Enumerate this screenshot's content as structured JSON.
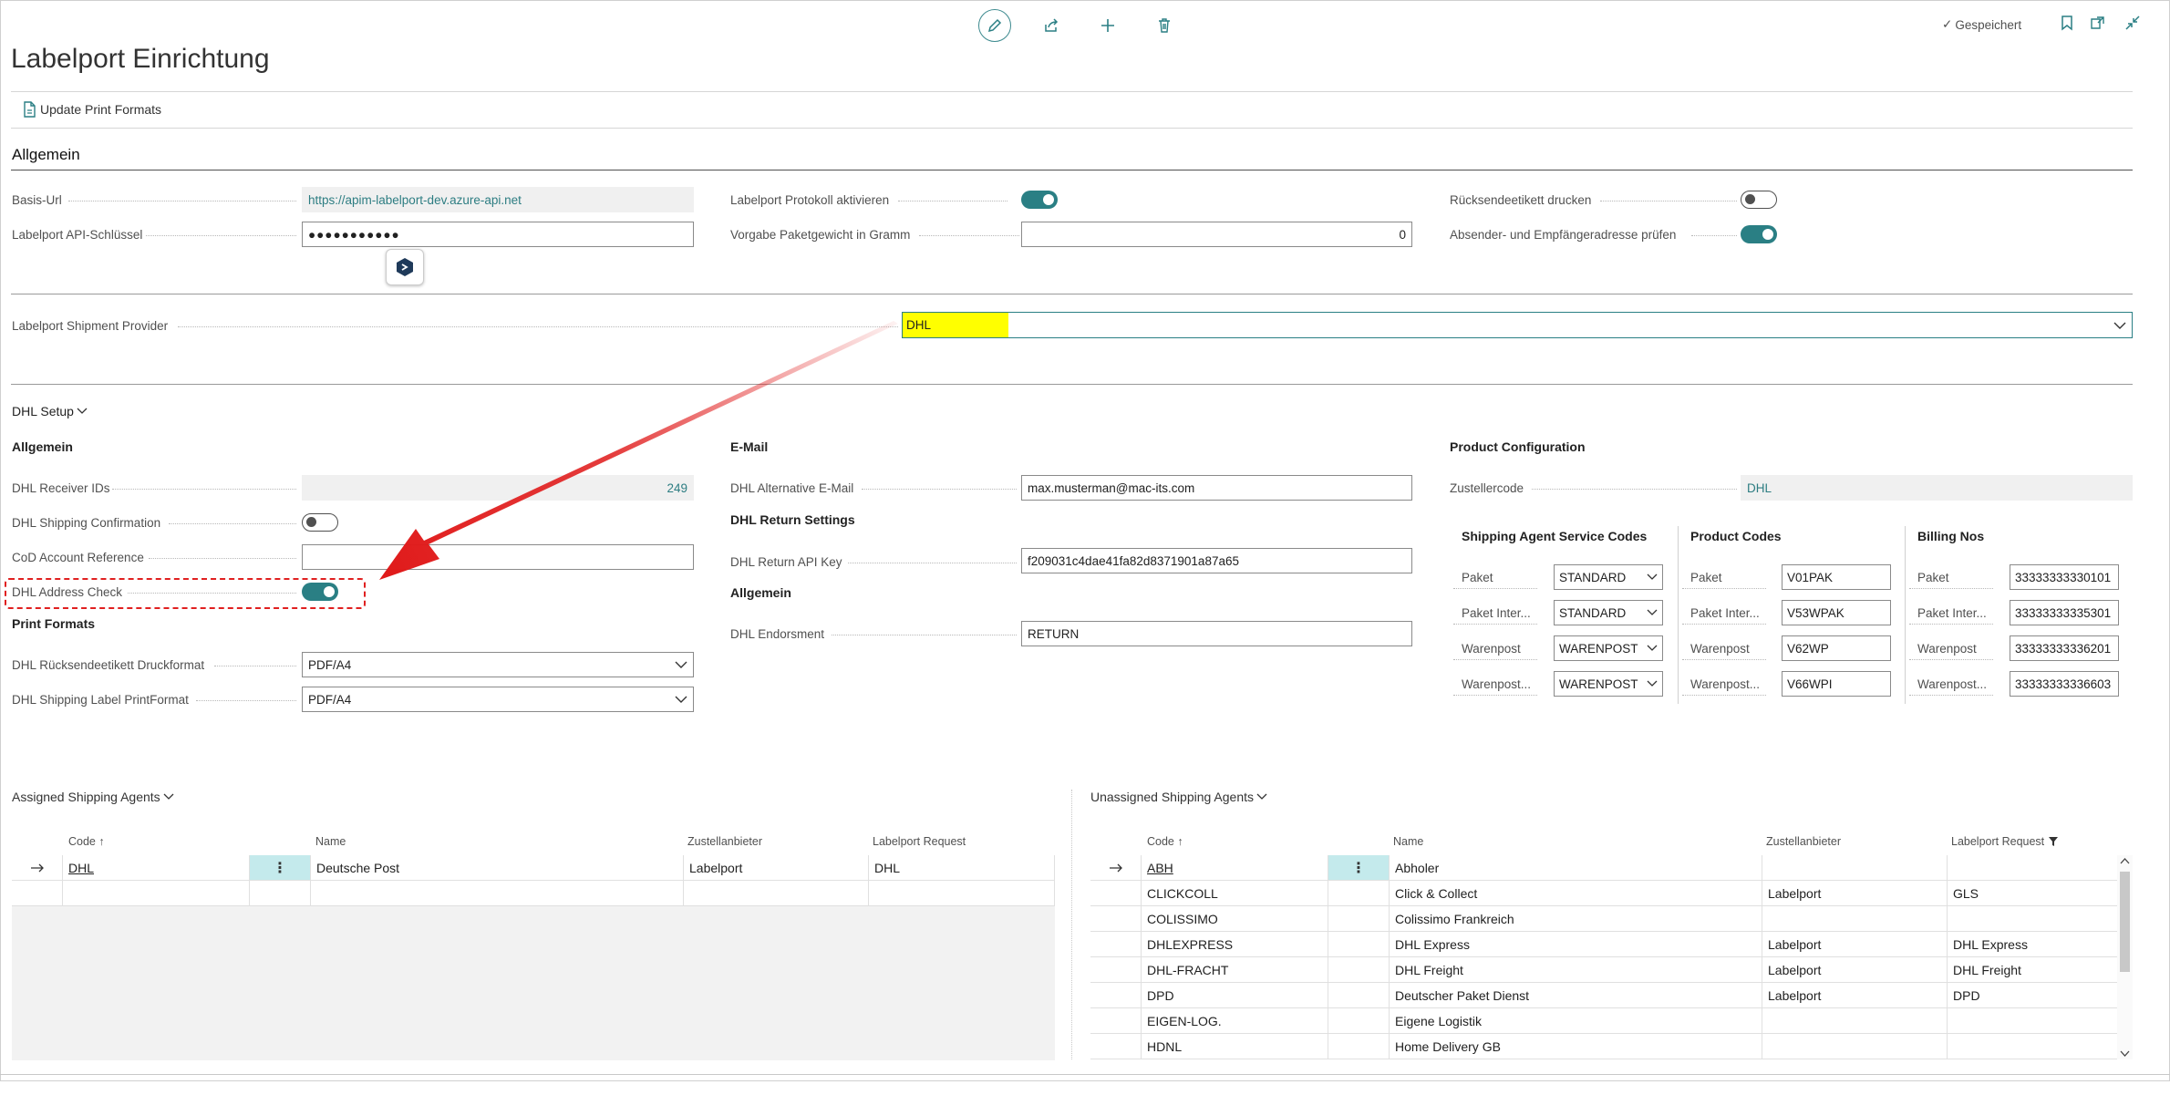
{
  "toolbar": {
    "saved_label": "Gespeichert"
  },
  "page": {
    "title": "Labelport Einrichtung"
  },
  "actions": {
    "update_print_formats": "Update Print Formats"
  },
  "general": {
    "heading": "Allgemein",
    "basis_url_label": "Basis-Url",
    "basis_url_value": "https://apim-labelport-dev.azure-api.net",
    "api_key_label": "Labelport API-Schlüssel",
    "api_key_value": "●●●●●●●●●●●",
    "protokoll_label": "Labelport Protokoll aktivieren",
    "protokoll_on": true,
    "paketgewicht_label": "Vorgabe Paketgewicht in Gramm",
    "paketgewicht_value": "0",
    "ruecksende_label": "Rücksendeetikett drucken",
    "ruecksende_on": false,
    "adresse_label": "Absender- und Empfängeradresse prüfen",
    "adresse_on": true,
    "provider_label": "Labelport Shipment Provider",
    "provider_value": "DHL"
  },
  "dhl": {
    "heading": "DHL Setup",
    "col1_heading": "Allgemein",
    "receiver_ids_label": "DHL Receiver IDs",
    "receiver_ids_value": "249",
    "shipping_conf_label": "DHL Shipping Confirmation",
    "cod_label": "CoD Account Reference",
    "cod_value": "",
    "address_check_label": "DHL Address Check",
    "print_formats_heading": "Print Formats",
    "ruecksende_format_label": "DHL Rücksendeetikett Druckformat",
    "ruecksende_format_value": "PDF/A4",
    "shipping_label_format_label": "DHL Shipping Label PrintFormat",
    "shipping_label_format_value": "PDF/A4",
    "email_heading": "E-Mail",
    "alt_email_label": "DHL Alternative E-Mail",
    "alt_email_value": "max.musterman@mac-its.com",
    "return_settings_heading": "DHL Return Settings",
    "return_api_key_label": "DHL Return API Key",
    "return_api_key_value": "f209031c4dae41fa82d8371901a87a65",
    "col2_allgemein_heading": "Allgemein",
    "endorsment_label": "DHL Endorsment",
    "endorsment_value": "RETURN",
    "product_config_heading": "Product Configuration",
    "zustellercode_label": "Zustellercode",
    "zustellercode_value": "DHL",
    "service_codes_heading": "Shipping Agent Service Codes",
    "product_codes_heading": "Product Codes",
    "billing_nos_heading": "Billing Nos",
    "service_codes": [
      {
        "label": "Paket",
        "value": "STANDARD"
      },
      {
        "label": "Paket Inter...",
        "value": "STANDARD"
      },
      {
        "label": "Warenpost",
        "value": "WARENPOST"
      },
      {
        "label": "Warenpost...",
        "value": "WARENPOST"
      }
    ],
    "product_codes": [
      {
        "label": "Paket",
        "value": "V01PAK"
      },
      {
        "label": "Paket Inter...",
        "value": "V53WPAK"
      },
      {
        "label": "Warenpost",
        "value": "V62WP"
      },
      {
        "label": "Warenpost...",
        "value": "V66WPI"
      }
    ],
    "billing_nos": [
      {
        "label": "Paket",
        "value": "33333333330101"
      },
      {
        "label": "Paket Inter...",
        "value": "33333333335301"
      },
      {
        "label": "Warenpost",
        "value": "33333333336201"
      },
      {
        "label": "Warenpost...",
        "value": "33333333336603"
      }
    ]
  },
  "assigned": {
    "caption": "Assigned Shipping Agents",
    "headers": {
      "code": "Code ↑",
      "name": "Name",
      "zustellanbieter": "Zustellanbieter",
      "request": "Labelport Request"
    },
    "rows": [
      {
        "code": "DHL",
        "name": "Deutsche Post",
        "zustellanbieter": "Labelport",
        "request": "DHL"
      }
    ]
  },
  "unassigned": {
    "caption": "Unassigned Shipping Agents",
    "headers": {
      "code": "Code ↑",
      "name": "Name",
      "zustellanbieter": "Zustellanbieter",
      "request": "Labelport Request"
    },
    "rows": [
      {
        "code": "ABH",
        "name": "Abholer",
        "zustellanbieter": "",
        "request": ""
      },
      {
        "code": "CLICKCOLL",
        "name": "Click & Collect",
        "zustellanbieter": "Labelport",
        "request": "GLS"
      },
      {
        "code": "COLISSIMO",
        "name": "Colissimo Frankreich",
        "zustellanbieter": "",
        "request": ""
      },
      {
        "code": "DHLEXPRESS",
        "name": "DHL Express",
        "zustellanbieter": "Labelport",
        "request": "DHL Express"
      },
      {
        "code": "DHL-FRACHT",
        "name": "DHL Freight",
        "zustellanbieter": "Labelport",
        "request": "DHL Freight"
      },
      {
        "code": "DPD",
        "name": "Deutscher Paket Dienst",
        "zustellanbieter": "Labelport",
        "request": "DPD"
      },
      {
        "code": "EIGEN-LOG.",
        "name": "Eigene Logistik",
        "zustellanbieter": "",
        "request": ""
      },
      {
        "code": "HDNL",
        "name": "Home Delivery GB",
        "zustellanbieter": "",
        "request": ""
      }
    ]
  },
  "colors": {
    "accent": "#2a7f84",
    "highlight": "#ffff00",
    "arrow": "#e01a1a"
  }
}
